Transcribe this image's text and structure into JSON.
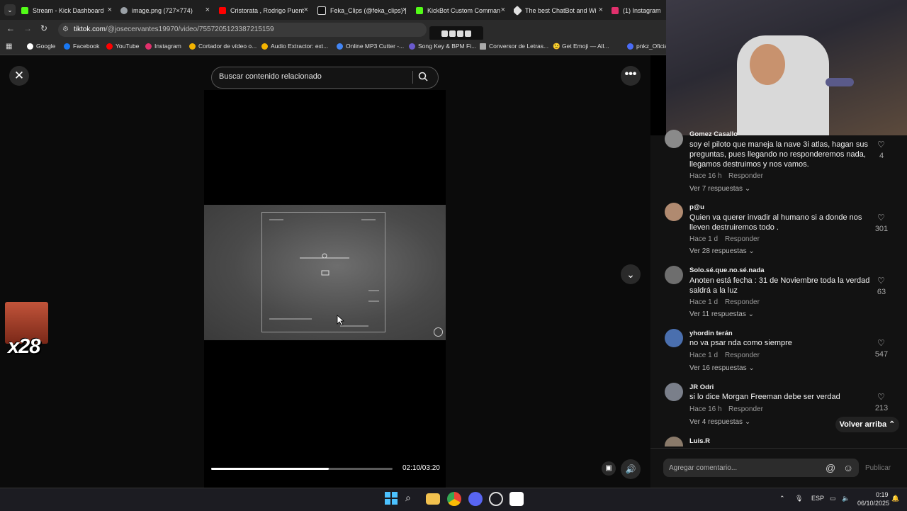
{
  "browser": {
    "tabs": [
      {
        "label": "Stream - Kick Dashboard",
        "color": "#53fc18"
      },
      {
        "label": "image.png (727×774)",
        "color": "#9aa0a6"
      },
      {
        "label": "Cristorata , Rodrigo Puent",
        "color": "#ff0000"
      },
      {
        "label": "Feka_Clips (@feka_clips) |",
        "color": "#ffffff"
      },
      {
        "label": "KickBot Custom Comman",
        "color": "#53fc18"
      },
      {
        "label": "The best ChatBot and Wi",
        "color": "#e0e0e0"
      },
      {
        "label": "(1) Instagram",
        "color": "#e1306c"
      }
    ],
    "url_domain": "tiktok.com",
    "url_path": "/@josecervantes19970/video/7557205123387215159",
    "bookmarks": [
      "Google",
      "Facebook",
      "YouTube",
      "Instagram",
      "Cortador de vídeo o...",
      "Audio Extractor: ext...",
      "Online MP3 Cutter -...",
      "Song Key & BPM Fi...",
      "Conversor de Letras...",
      "😉 Get Emoji — All...",
      "pnkz_Oficial"
    ]
  },
  "player": {
    "search_placeholder": "Buscar contenido relacionado",
    "time": "02:10/03:20",
    "progress": 0.65
  },
  "overlay": {
    "multiplier": "x28"
  },
  "comments": [
    {
      "name": "Gomez Casallo",
      "text": "soy el piloto que maneja la nave 3i atlas, hagan sus preguntas, pues llegando no responderemos nada, llegamos destruimos y nos vamos.",
      "time": "Hace 16 h",
      "reply": "Responder",
      "replies": "Ver 7 respuestas",
      "likes": "4"
    },
    {
      "name": "p@u",
      "text": "Quien va querer invadir al humano si a donde nos lleven destruiremos todo .",
      "time": "Hace 1 d",
      "reply": "Responder",
      "replies": "Ver 28 respuestas",
      "likes": "301"
    },
    {
      "name": "Solo.sé.que.no.sé.nada",
      "text": "Anoten está fecha : 31 de Noviembre toda la verdad saldrá a la luz",
      "time": "Hace 1 d",
      "reply": "Responder",
      "replies": "Ver 11 respuestas",
      "likes": "63"
    },
    {
      "name": "yhordin terán",
      "text": "no va psar nda como siempre",
      "time": "Hace 1 d",
      "reply": "Responder",
      "replies": "Ver 16 respuestas",
      "likes": "547"
    },
    {
      "name": "JR Odri",
      "text": "si lo dice Morgan Freeman debe ser verdad",
      "time": "Hace 16 h",
      "reply": "Responder",
      "replies": "Ver 4 respuestas",
      "likes": "213"
    },
    {
      "name": "Luis.R",
      "text": "",
      "time": "",
      "reply": "",
      "replies": "",
      "likes": ""
    }
  ],
  "ui": {
    "back_to_top": "Volver arriba",
    "add_comment_placeholder": "Agregar comentario...",
    "publish": "Publicar"
  },
  "taskbar": {
    "lang": "ESP",
    "time": "0:19",
    "date": "06/10/2025"
  }
}
